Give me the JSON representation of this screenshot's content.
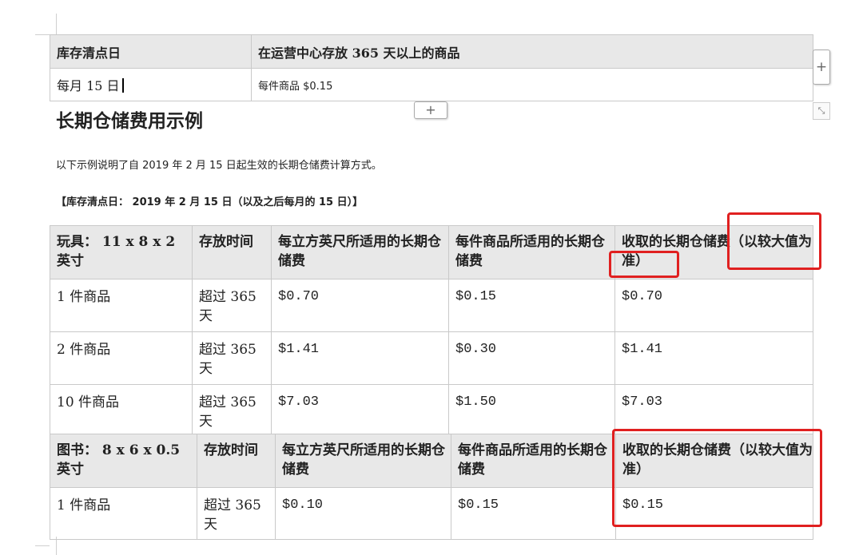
{
  "info_table": {
    "header": [
      "库存清点日",
      "在运营中心存放 365 天以上的商品"
    ],
    "row": [
      "每月 15 日",
      "每件商品 $0.15"
    ]
  },
  "controls": {
    "add_symbol": "+",
    "resize_symbol": "⤡"
  },
  "section_title": "长期仓储费用示例",
  "intro_text": "以下示例说明了自 2019 年 2 月 15 日起生效的长期仓储费计算方式。",
  "inventory_date_note": "【库存清点日： 2019 年 2 月 15 日（以及之后每月的 15 日）】",
  "toys_table": {
    "header": [
      "玩具： 11 x 8 x 2 英寸",
      "存放时间",
      "每立方英尺所适用的长期仓储费",
      "每件商品所适用的长期仓储费",
      "收取的长期仓储费（以较大值为准）"
    ],
    "rows": [
      [
        "1 件商品",
        "超过 365 天",
        "$0.70",
        "$0.15",
        "$0.70"
      ],
      [
        "2 件商品",
        "超过 365 天",
        "$1.41",
        "$0.30",
        "$1.41"
      ],
      [
        "10 件商品",
        "超过 365 天",
        "$7.03",
        "$1.50",
        "$7.03"
      ]
    ]
  },
  "books_table": {
    "header": [
      "图书： 8 x 6 x 0.5 英寸",
      "存放时间",
      "每立方英尺所适用的长期仓储费",
      "每件商品所适用的长期仓储费",
      "收取的长期仓储费（以较大值为准）"
    ],
    "rows": [
      [
        "1 件商品",
        "超过 365 天",
        "$0.10",
        "$0.15",
        "$0.15"
      ]
    ]
  },
  "annotation_color": "#e02020"
}
